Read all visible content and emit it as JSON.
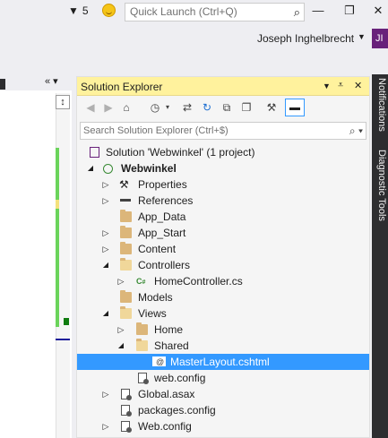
{
  "titlebar": {
    "filter_count": "5",
    "quick_launch_placeholder": "Quick Launch (Ctrl+Q)",
    "user_name": "Joseph Inghelbrecht",
    "avatar_initials": "JI"
  },
  "solution_explorer": {
    "title": "Solution Explorer",
    "search_placeholder": "Search Solution Explorer (Ctrl+$)",
    "tree": [
      {
        "label": "Solution 'Webwinkel' (1 project)",
        "icon": "solution-icon"
      },
      {
        "label": "Webwinkel",
        "icon": "web-project-icon",
        "bold": true
      },
      {
        "label": "Properties",
        "icon": "wrench-icon"
      },
      {
        "label": "References",
        "icon": "references-icon"
      },
      {
        "label": "App_Data",
        "icon": "folder-icon"
      },
      {
        "label": "App_Start",
        "icon": "folder-icon"
      },
      {
        "label": "Content",
        "icon": "folder-icon"
      },
      {
        "label": "Controllers",
        "icon": "folder-open-icon"
      },
      {
        "label": "HomeController.cs",
        "icon": "csharp-file-icon"
      },
      {
        "label": "Models",
        "icon": "folder-icon"
      },
      {
        "label": "Views",
        "icon": "folder-open-icon"
      },
      {
        "label": "Home",
        "icon": "folder-icon"
      },
      {
        "label": "Shared",
        "icon": "folder-open-icon"
      },
      {
        "label": "MasterLayout.cshtml",
        "icon": "cshtml-file-icon",
        "selected": true
      },
      {
        "label": "web.config",
        "icon": "config-file-icon"
      },
      {
        "label": "Global.asax",
        "icon": "asax-file-icon"
      },
      {
        "label": "packages.config",
        "icon": "config-file-icon"
      },
      {
        "label": "Web.config",
        "icon": "config-file-icon"
      }
    ]
  },
  "side_tabs": [
    "Notifications",
    "Diagnostic Tools"
  ],
  "colors": {
    "title_bar_active": "#fff29d",
    "selection": "#3399ff",
    "side_tab_bg": "#2d2d30"
  }
}
